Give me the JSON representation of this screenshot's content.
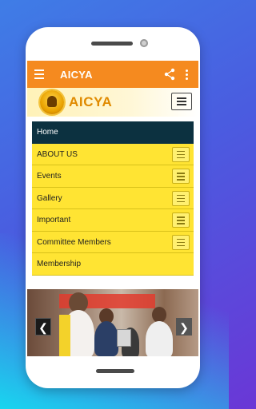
{
  "app": {
    "title": "AICYA",
    "logo_text": "AICYA",
    "appbar_color": "#f58a1f"
  },
  "icons": {
    "menu": "menu-icon",
    "share": "share-icon",
    "more": "more-vertical-icon",
    "nav_toggle": "hamburger-icon",
    "prev": "chevron-left-icon",
    "next": "chevron-right-icon"
  },
  "nav": {
    "items": [
      {
        "label": "Home",
        "active": true,
        "has_toggle": false
      },
      {
        "label": "ABOUT US",
        "active": false,
        "has_toggle": true
      },
      {
        "label": "Events",
        "active": false,
        "has_toggle": true
      },
      {
        "label": "Gallery",
        "active": false,
        "has_toggle": true
      },
      {
        "label": "Important",
        "active": false,
        "has_toggle": true
      },
      {
        "label": "Committee Members",
        "active": false,
        "has_toggle": true
      },
      {
        "label": "Membership",
        "active": false,
        "has_toggle": false
      }
    ]
  },
  "slider": {
    "prev_label": "❮",
    "next_label": "❯"
  },
  "colors": {
    "nav_active": "#0c3140",
    "nav_bg": "#ffe433",
    "logo_text": "#e08a00"
  }
}
